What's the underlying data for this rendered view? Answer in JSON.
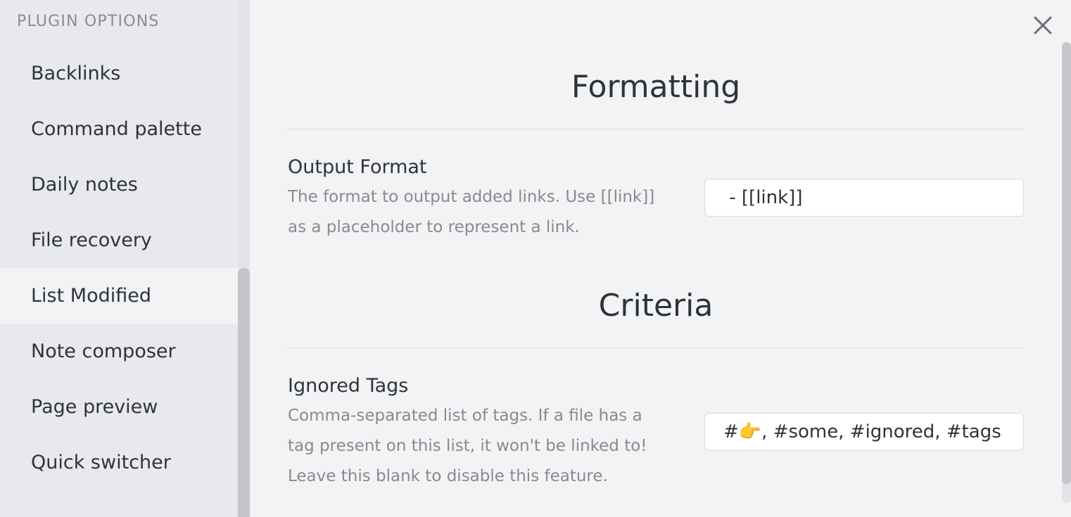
{
  "sidebar": {
    "heading": "PLUGIN OPTIONS",
    "items": [
      {
        "label": "Backlinks"
      },
      {
        "label": "Command palette"
      },
      {
        "label": "Daily notes"
      },
      {
        "label": "File recovery"
      },
      {
        "label": "List Modified",
        "active": true
      },
      {
        "label": "Note composer"
      },
      {
        "label": "Page preview"
      },
      {
        "label": "Quick switcher"
      }
    ]
  },
  "close": {
    "icon": "close-icon"
  },
  "sections": {
    "formatting": {
      "title": "Formatting",
      "output_format": {
        "name": "Output Format",
        "desc_line1": "The format to output added links. Use [[link]]",
        "desc_line2": "as a placeholder to represent a link.",
        "value": " - [[link]]"
      }
    },
    "criteria": {
      "title": "Criteria",
      "ignored_tags": {
        "name": "Ignored Tags",
        "desc_line1": "Comma-separated list of tags. If a file has a",
        "desc_line2": "tag present on this list, it won't be linked to!",
        "desc_line3": "Leave this blank to disable this feature.",
        "value": "#👉, #some, #ignored, #tags"
      }
    }
  },
  "colors": {
    "background": "#f2f3f5",
    "sidebar": "#e8e9ec",
    "text": "#2e3338",
    "muted": "#888a8f"
  }
}
